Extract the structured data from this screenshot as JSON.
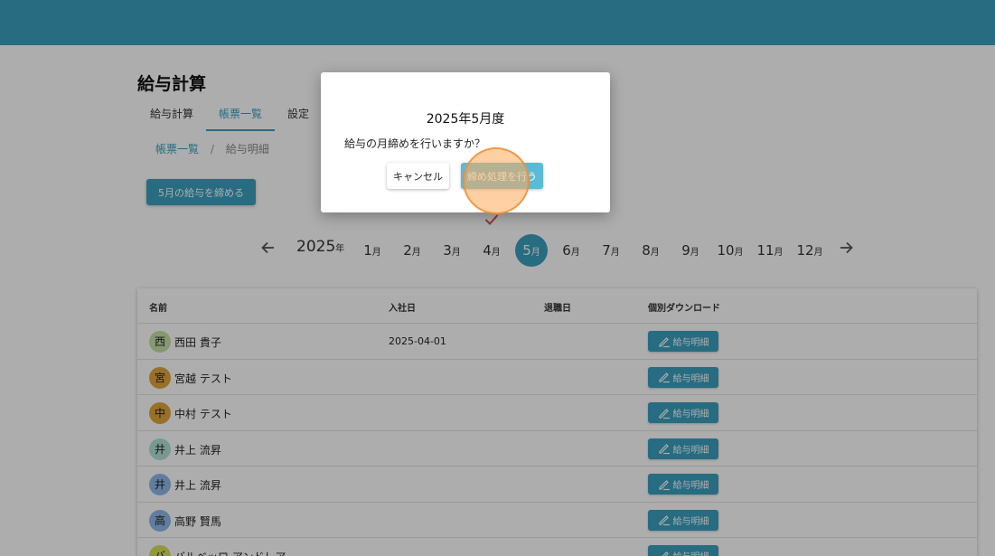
{
  "header": {
    "color": "#3a9fbf"
  },
  "page": {
    "title": "給与計算"
  },
  "tabs": [
    {
      "label": "給与計算",
      "active": false
    },
    {
      "label": "帳票一覧",
      "active": true
    },
    {
      "label": "設定",
      "active": false
    }
  ],
  "breadcrumb": {
    "parent": "帳票一覧",
    "separator": "/",
    "current": "給与明細"
  },
  "actions": {
    "close_month": "5月の給与を締める"
  },
  "month_nav": {
    "year": "2025",
    "year_suffix": "年",
    "month_suffix": "月",
    "months": [
      "1",
      "2",
      "3",
      "4",
      "5",
      "6",
      "7",
      "8",
      "9",
      "10",
      "11",
      "12"
    ],
    "selected_month": "5",
    "checked_month": "4",
    "prev_icon": "arrow-left-icon",
    "next_icon": "arrow-right-icon"
  },
  "table": {
    "headers": {
      "name": "名前",
      "join_date": "入社日",
      "leave_date": "退職日",
      "download": "個別ダウンロード"
    },
    "download_label": "給与明細",
    "rows": [
      {
        "initial": "西",
        "name": "西田 貴子",
        "join_date": "2025-04-01",
        "leave_date": "",
        "avatar_color": "#c5e1a5"
      },
      {
        "initial": "宮",
        "name": "宮越 テスト",
        "join_date": "",
        "leave_date": "",
        "avatar_color": "#e0a53a"
      },
      {
        "initial": "中",
        "name": "中村 テスト",
        "join_date": "",
        "leave_date": "",
        "avatar_color": "#e0a53a"
      },
      {
        "initial": "井",
        "name": "井上 流昇",
        "join_date": "",
        "leave_date": "",
        "avatar_color": "#b2e0d8"
      },
      {
        "initial": "井",
        "name": "井上 流昇",
        "join_date": "",
        "leave_date": "",
        "avatar_color": "#8fb8e8"
      },
      {
        "initial": "高",
        "name": "高野 賢馬",
        "join_date": "",
        "leave_date": "",
        "avatar_color": "#8fb8e8"
      },
      {
        "initial": "バ",
        "name": "バルベッロ アンドレア",
        "join_date": "",
        "leave_date": "",
        "avatar_color": "#d4e157"
      }
    ]
  },
  "dialog": {
    "title": "2025年5月度",
    "message": "給与の月締めを行いますか？",
    "cancel_label": "キャンセル",
    "confirm_label": "締め処理を行う"
  }
}
